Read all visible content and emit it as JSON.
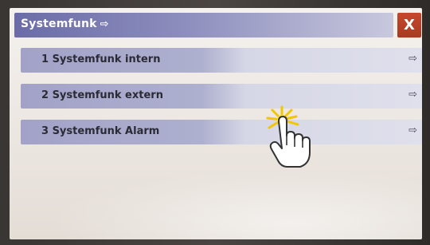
{
  "dialog": {
    "title": "Systemfunk",
    "title_arrow": "⇨",
    "close_label": "X"
  },
  "menu": {
    "items": [
      {
        "label": "1 Systemfunk intern",
        "arrow": "⇨"
      },
      {
        "label": "2 Systemfunk extern",
        "arrow": "⇨"
      },
      {
        "label": "3 Systemfunk Alarm",
        "arrow": "⇨"
      }
    ]
  },
  "colors": {
    "titlebar": "#6b6ca7",
    "close_button": "#b53f26",
    "menu_item": "#a2a2c8",
    "screen_background": "#efebe7"
  },
  "icons": {
    "title_arrow": "right-arrow-icon",
    "item_arrow": "right-arrow-icon",
    "cursor": "hand-pointer-icon"
  }
}
